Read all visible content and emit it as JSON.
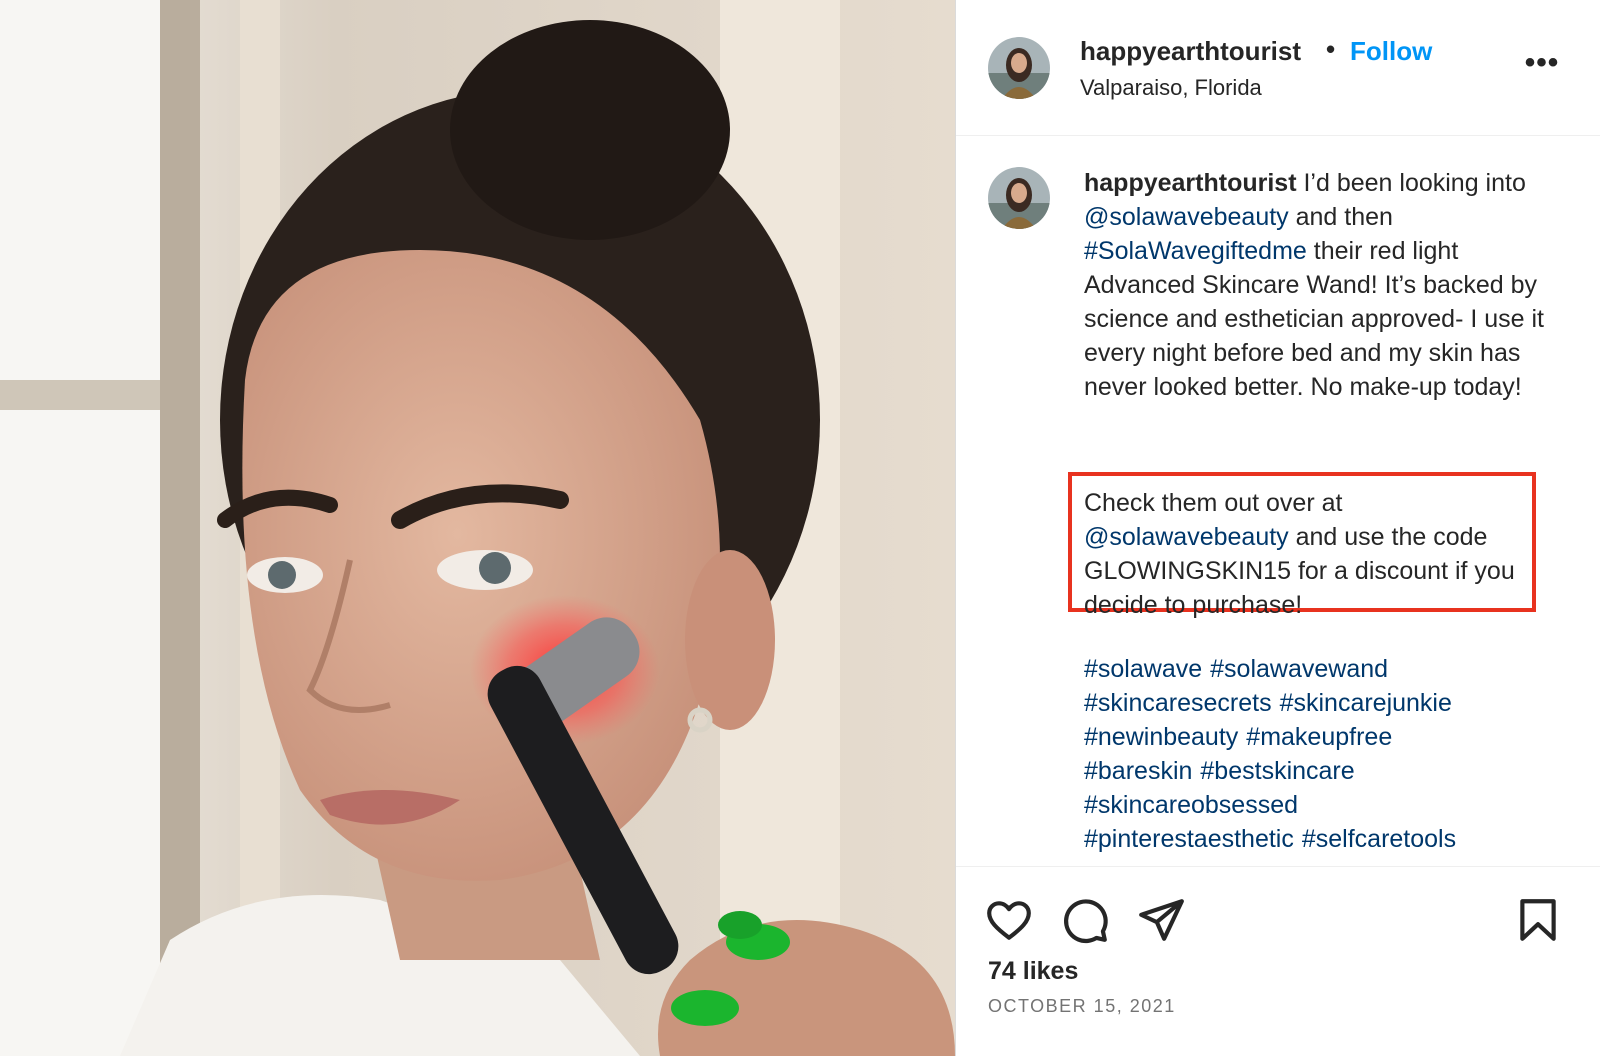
{
  "photo": {
    "alt_icon": "post-photo",
    "colors": {
      "red_light": "#ff3b3b",
      "nail_polish": "#1bb52e",
      "wand": "#1d1d1f"
    }
  },
  "header": {
    "username": "happyearthtourist",
    "dot": "•",
    "follow_label": "Follow",
    "location": "Valparaiso, Florida",
    "more_icon": "more-options-icon"
  },
  "caption": {
    "username": "happyearthtourist",
    "text_1": " I’d been looking into ",
    "mention_1": "@solawavebeauty",
    "text_2": " and then ",
    "hashtag_1": "#SolaWavegiftedme",
    "text_3": " their red light Advanced Skincare Wand! It’s backed by science and esthetician approved- I use it every night before bed and my skin has never looked better. No make-up today!"
  },
  "highlight": {
    "text_1": "Check them out over at ",
    "mention": "@solawavebeauty",
    "text_2": " and use the code GLOWINGSKIN15 for a discount if you decide to purchase!",
    "border_color": "#e8321f"
  },
  "hashtags": [
    "#solawave",
    "#solawavewand",
    "#skincaresecrets",
    "#skincarejunkie",
    "#newinbeauty",
    "#makeupfree",
    "#bareskin",
    "#bestskincare",
    "#skincareobsessed",
    "#pinterestaesthetic",
    "#selfcaretools"
  ],
  "actions": {
    "like_icon": "heart-icon",
    "comment_icon": "comment-icon",
    "share_icon": "share-icon",
    "save_icon": "bookmark-icon"
  },
  "likes": "74 likes",
  "date": "OCTOBER 15, 2021",
  "colors": {
    "link": "#0095f6",
    "tag": "#00376b",
    "text": "#262626",
    "muted": "#737373"
  }
}
